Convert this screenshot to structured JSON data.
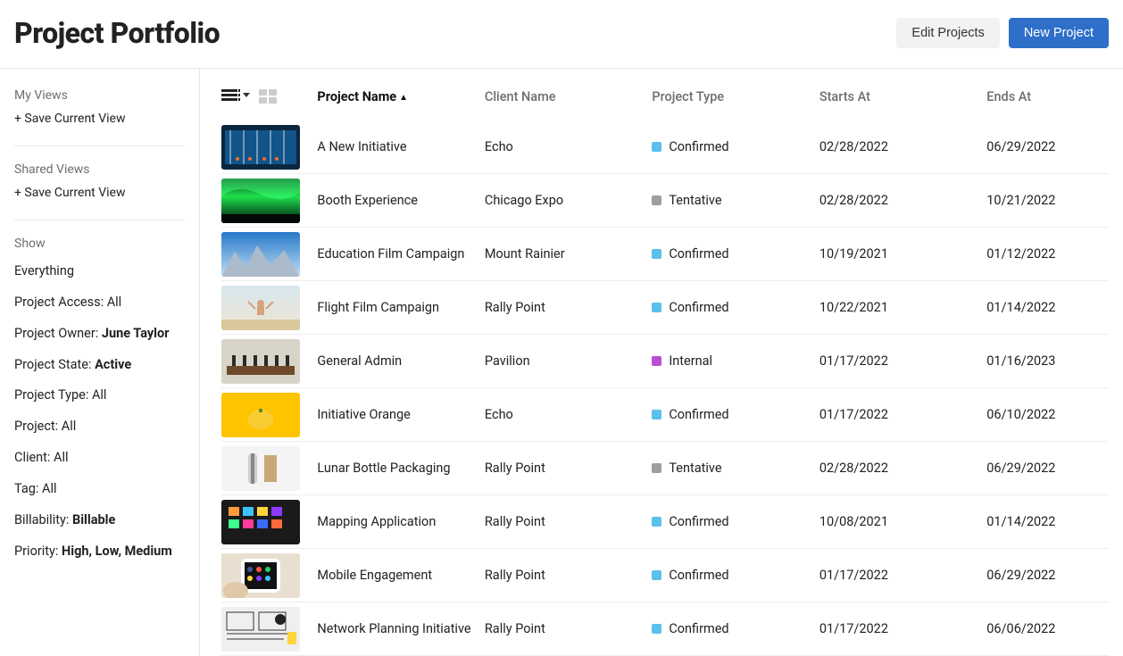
{
  "header": {
    "title": "Project Portfolio",
    "edit_label": "Edit Projects",
    "new_label": "New Project"
  },
  "sidebar": {
    "my_views_heading": "My Views",
    "save_current_view": "+ Save Current View",
    "shared_views_heading": "Shared Views",
    "show_heading": "Show",
    "filters": {
      "everything": "Everything",
      "project_access_label": "Project Access: ",
      "project_access_value": "All",
      "project_owner_label": "Project Owner: ",
      "project_owner_value": "June Taylor",
      "project_state_label": "Project State: ",
      "project_state_value": "Active",
      "project_type_label": "Project Type: ",
      "project_type_value": "All",
      "project_label": "Project: ",
      "project_value": "All",
      "client_label": "Client: ",
      "client_value": "All",
      "tag_label": "Tag: ",
      "tag_value": "All",
      "billability_label": "Billability: ",
      "billability_value": "Billable",
      "priority_label": "Priority: ",
      "priority_value": "High, Low, Medium"
    }
  },
  "columns": {
    "name": "Project Name",
    "client": "Client Name",
    "type": "Project Type",
    "start": "Starts At",
    "end": "Ends At"
  },
  "status_labels": {
    "confirmed": "Confirmed",
    "tentative": "Tentative",
    "internal": "Internal"
  },
  "rows": [
    {
      "name": "A New Initiative",
      "client": "Echo",
      "type": "confirmed",
      "start": "02/28/2022",
      "end": "06/29/2022",
      "thumb": "thumb0"
    },
    {
      "name": "Booth Experience",
      "client": "Chicago Expo",
      "type": "tentative",
      "start": "02/28/2022",
      "end": "10/21/2022",
      "thumb": "thumb1"
    },
    {
      "name": "Education Film Campaign",
      "client": "Mount Rainier",
      "type": "confirmed",
      "start": "10/19/2021",
      "end": "01/12/2022",
      "thumb": "thumb2"
    },
    {
      "name": "Flight Film Campaign",
      "client": "Rally Point",
      "type": "confirmed",
      "start": "10/22/2021",
      "end": "01/14/2022",
      "thumb": "thumb3"
    },
    {
      "name": "General Admin",
      "client": "Pavilion",
      "type": "internal",
      "start": "01/17/2022",
      "end": "01/16/2023",
      "thumb": "thumb4"
    },
    {
      "name": "Initiative Orange",
      "client": "Echo",
      "type": "confirmed",
      "start": "01/17/2022",
      "end": "06/10/2022",
      "thumb": "thumb5"
    },
    {
      "name": "Lunar Bottle Packaging",
      "client": "Rally Point",
      "type": "tentative",
      "start": "02/28/2022",
      "end": "06/29/2022",
      "thumb": "thumb6"
    },
    {
      "name": "Mapping Application",
      "client": "Rally Point",
      "type": "confirmed",
      "start": "10/08/2021",
      "end": "01/14/2022",
      "thumb": "thumb7"
    },
    {
      "name": "Mobile Engagement",
      "client": "Rally Point",
      "type": "confirmed",
      "start": "01/17/2022",
      "end": "06/29/2022",
      "thumb": "thumb8"
    },
    {
      "name": "Network Planning Initiative",
      "client": "Rally Point",
      "type": "confirmed",
      "start": "01/17/2022",
      "end": "06/06/2022",
      "thumb": "thumb9"
    }
  ]
}
